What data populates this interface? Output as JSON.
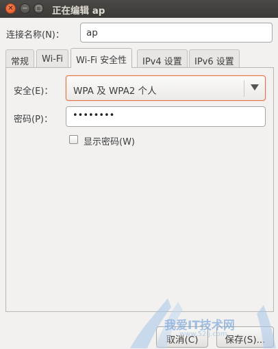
{
  "window": {
    "title": "正在编辑 ap",
    "close_glyph": "✕",
    "min_glyph": "−",
    "max_glyph": "□"
  },
  "connection": {
    "label": "连接名称(N)：",
    "value": "ap"
  },
  "tabs": [
    {
      "label": "常规"
    },
    {
      "label": "Wi-Fi"
    },
    {
      "label": "Wi-Fi 安全性",
      "active": true
    },
    {
      "label": "IPv4 设置"
    },
    {
      "label": "IPv6 设置"
    }
  ],
  "security": {
    "label": "安全(E)：",
    "value": "WPA 及 WPA2 个人"
  },
  "password": {
    "label": "密码(P)：",
    "value": "••••••••"
  },
  "show_password": {
    "label": "显示密码(W)",
    "checked": false
  },
  "buttons": {
    "cancel": "取消(C)",
    "save": "保存(S)..."
  },
  "watermark": {
    "text": "我爱IT技术网",
    "sub": "www.52ij.com"
  },
  "colors": {
    "titlebar": "#3c3b37",
    "close": "#e3541d",
    "focus": "#e0774a"
  }
}
